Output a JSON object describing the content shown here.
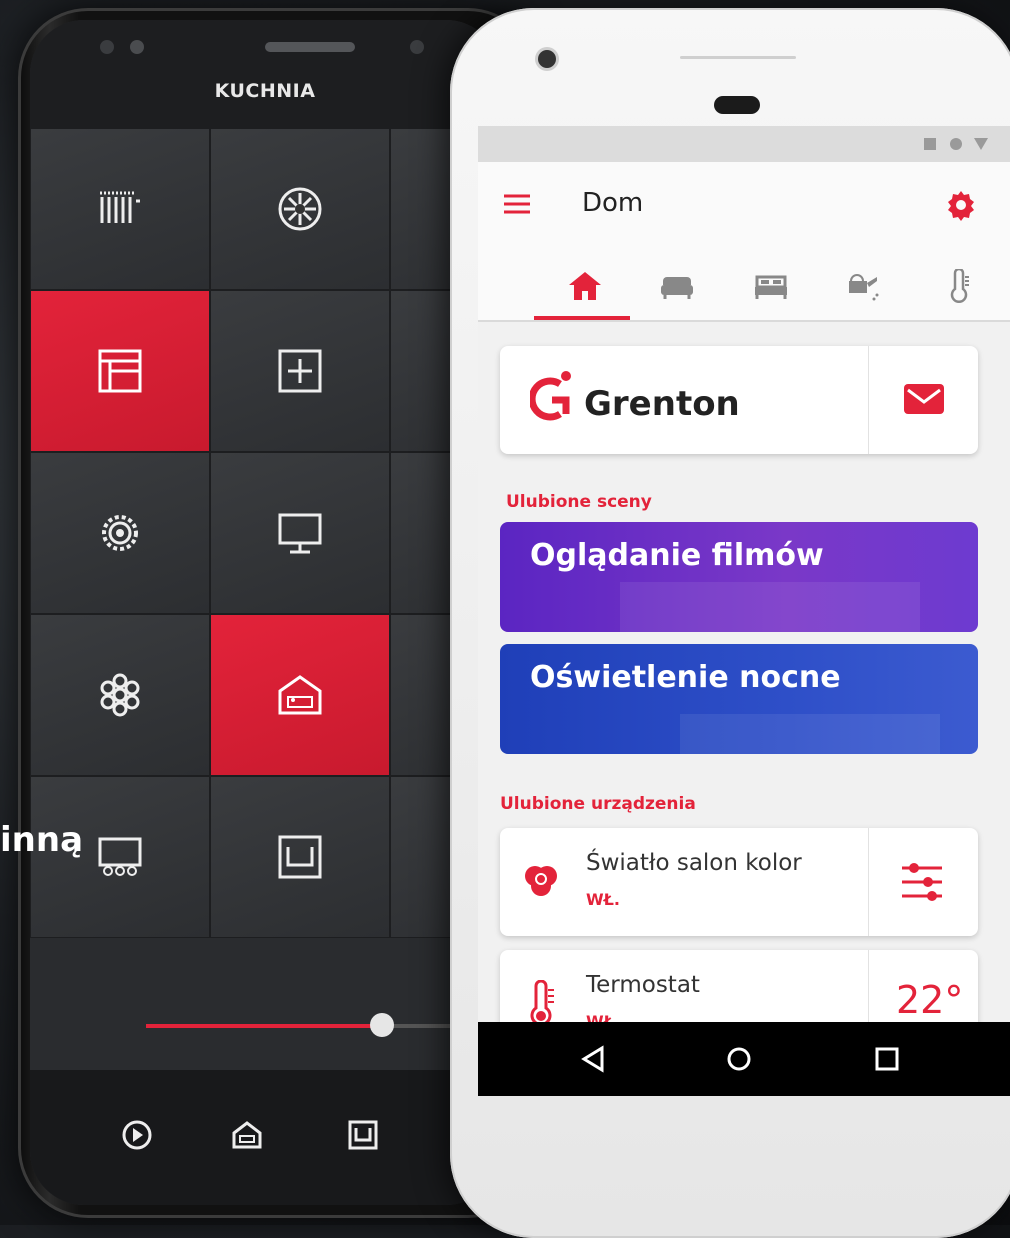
{
  "dark_phone": {
    "room_title": "KUCHNIA",
    "side_text": "inną"
  },
  "app": {
    "title": "Dom",
    "brand": "Grenton",
    "accent": "#e3233a",
    "tabs": [
      "home-icon",
      "armchair-icon",
      "bed-icon",
      "watering-can-icon",
      "thermometer-icon"
    ],
    "active_tab": 0,
    "favorite_scenes_label": "Ulubione sceny",
    "scenes": [
      {
        "label": "Oglądanie filmów",
        "color": "#6a2bc4"
      },
      {
        "label": "Oświetlenie nocne",
        "color": "#2a46c4"
      }
    ],
    "favorite_devices_label": "Ulubione urządzenia",
    "devices": [
      {
        "name": "Światło salon kolor",
        "state": "WŁ.",
        "icon": "rgb-light-icon",
        "action": "sliders-icon"
      },
      {
        "name": "Termostat",
        "state": "WŁ.",
        "icon": "thermometer-icon",
        "value": "22°"
      }
    ]
  }
}
